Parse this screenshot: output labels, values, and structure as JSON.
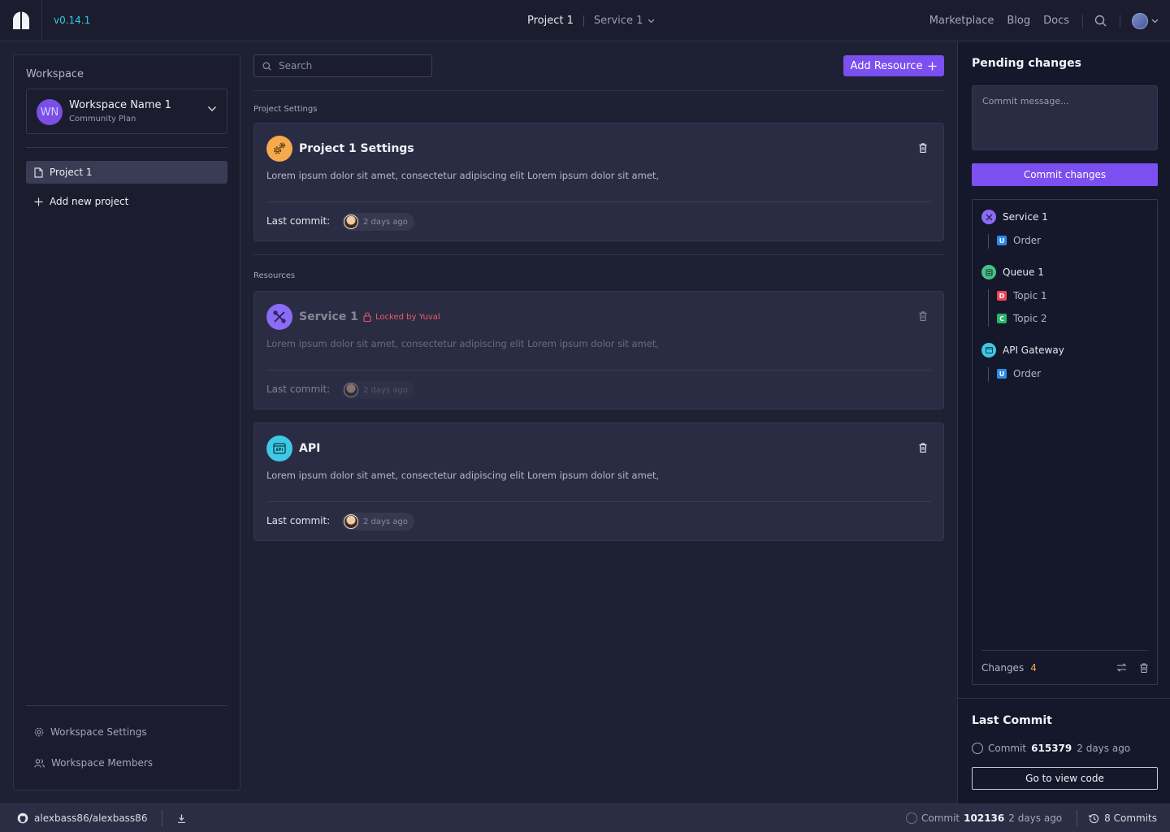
{
  "header": {
    "version": "v0.14.1",
    "breadcrumb": [
      "Project 1",
      "Service 1"
    ],
    "links": [
      "Marketplace",
      "Blog",
      "Docs"
    ]
  },
  "sidebar": {
    "section_label": "Workspace",
    "workspace": {
      "initials": "WN",
      "name": "Workspace Name 1",
      "plan": "Community Plan"
    },
    "projects": [
      {
        "label": "Project 1"
      }
    ],
    "add_project_label": "Add new project",
    "footer_links": [
      "Workspace Settings",
      "Workspace Members"
    ]
  },
  "main": {
    "search_placeholder": "Search",
    "add_resource_label": "Add Resource",
    "project_settings_label": "Project Settings",
    "resources_label": "Resources",
    "cards": [
      {
        "title": "Project 1 Settings",
        "description": "Lorem ipsum dolor sit amet, consectetur adipiscing elit Lorem ipsum dolor sit amet,",
        "last_commit_label": "Last commit:",
        "last_commit_time": "2 days ago",
        "icon": "settings-gears-icon",
        "color": "#f6a94d"
      },
      {
        "title": "Service 1",
        "lock_label": "Locked by Yuval",
        "description": "Lorem ipsum dolor sit amet, consectetur adipiscing elit Lorem ipsum dolor sit amet,",
        "last_commit_label": "Last commit:",
        "last_commit_time": "2 days ago",
        "icon": "tools-icon",
        "color": "#8b6cf5",
        "locked": true
      },
      {
        "title": "API",
        "description": "Lorem ipsum dolor sit amet, consectetur adipiscing elit Lorem ipsum dolor sit amet,",
        "last_commit_label": "Last commit:",
        "last_commit_time": "2 days ago",
        "icon": "api-icon",
        "color": "#3ec9e6"
      }
    ]
  },
  "pending": {
    "title": "Pending changes",
    "commit_placeholder": "Commit message...",
    "commit_button": "Commit changes",
    "tree": [
      {
        "label": "Service 1",
        "icon": "tools-icon",
        "color": "#8b6cf5",
        "children": [
          {
            "badge": "U",
            "badge_color": "#2b8be8",
            "label": "Order"
          }
        ]
      },
      {
        "label": "Queue 1",
        "icon": "queue-icon",
        "color": "#4bbf8a",
        "children": [
          {
            "badge": "D",
            "badge_color": "#f0455a",
            "label": "Topic 1"
          },
          {
            "badge": "C",
            "badge_color": "#27b86a",
            "label": "Topic 2"
          }
        ]
      },
      {
        "label": "API Gateway",
        "icon": "api-icon",
        "color": "#3ec9e6",
        "children": [
          {
            "badge": "U",
            "badge_color": "#2b8be8",
            "label": "Order"
          }
        ]
      }
    ],
    "changes_label": "Changes",
    "changes_count": "4",
    "changes_count_color": "#f6a94d"
  },
  "last_commit": {
    "title": "Last Commit",
    "commit_label": "Commit",
    "commit_id": "615379",
    "time": "2 days ago",
    "view_code_button": "Go to view code"
  },
  "footer": {
    "repo": "alexbass86/alexbass86",
    "commit_label": "Commit",
    "commit_id": "102136",
    "commit_time": "2 days ago",
    "commits_count": "8 Commits"
  }
}
